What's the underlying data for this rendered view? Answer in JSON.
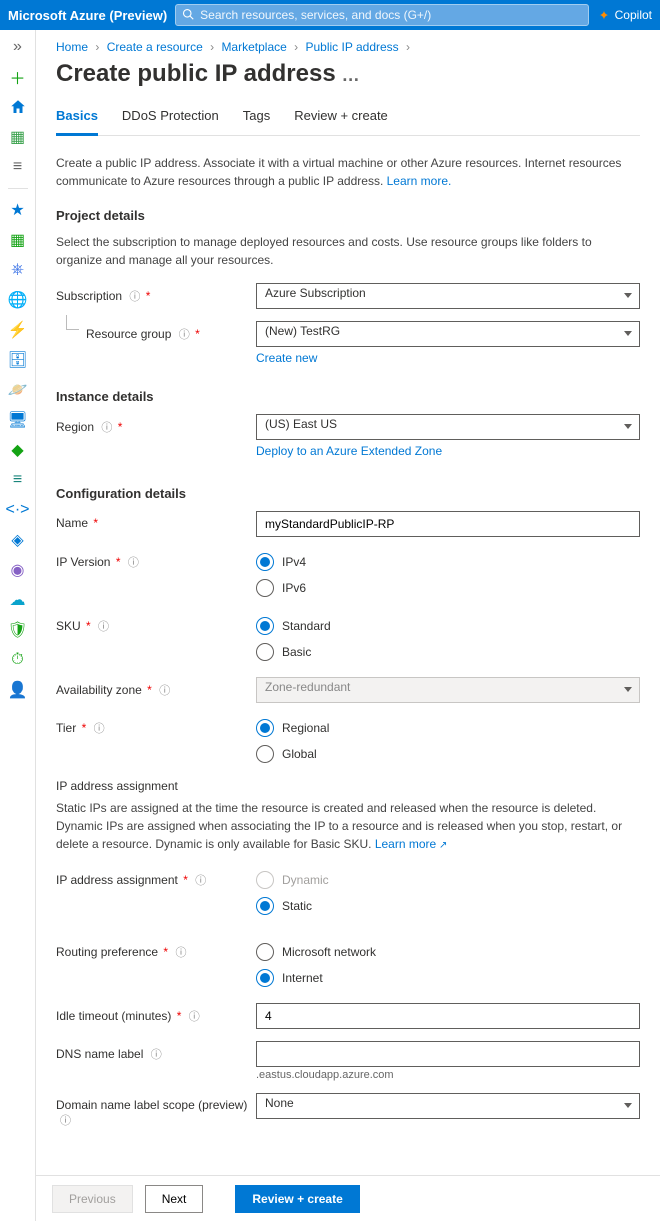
{
  "topbar": {
    "brand": "Microsoft Azure (Preview)",
    "search_placeholder": "Search resources, services, and docs (G+/)",
    "copilot": "Copilot"
  },
  "breadcrumb": {
    "items": [
      "Home",
      "Create a resource",
      "Marketplace",
      "Public IP address"
    ]
  },
  "page": {
    "title": "Create public IP address"
  },
  "tabs": {
    "items": [
      "Basics",
      "DDoS Protection",
      "Tags",
      "Review + create"
    ],
    "active": 0
  },
  "intro": {
    "text": "Create a public IP address. Associate it with a virtual machine or other Azure resources. Internet resources communicate to Azure resources through a public IP address. ",
    "learn_more": "Learn more."
  },
  "project": {
    "heading": "Project details",
    "help": "Select the subscription to manage deployed resources and costs. Use resource groups like folders to organize and manage all your resources.",
    "subscription_label": "Subscription",
    "subscription_value": "Azure Subscription",
    "rg_label": "Resource group",
    "rg_value": "(New) TestRG",
    "create_new": "Create new"
  },
  "instance": {
    "heading": "Instance details",
    "region_label": "Region",
    "region_value": "(US) East US",
    "extended_zone": "Deploy to an Azure Extended Zone"
  },
  "config": {
    "heading": "Configuration details",
    "name_label": "Name",
    "name_value": "myStandardPublicIP-RP",
    "ipver_label": "IP Version",
    "ipver_options": [
      "IPv4",
      "IPv6"
    ],
    "ipver_selected": "IPv4",
    "sku_label": "SKU",
    "sku_options": [
      "Standard",
      "Basic"
    ],
    "sku_selected": "Standard",
    "avzone_label": "Availability zone",
    "avzone_value": "Zone-redundant",
    "tier_label": "Tier",
    "tier_options": [
      "Regional",
      "Global"
    ],
    "tier_selected": "Regional"
  },
  "ipassign": {
    "heading": "IP address assignment",
    "desc": "Static IPs are assigned at the time the resource is created and released when the resource is deleted. Dynamic IPs are assigned when associating the IP to a resource and is released when you stop, restart, or delete a resource. Dynamic is only available for Basic SKU. ",
    "learn_more": "Learn more",
    "label": "IP address assignment",
    "options": [
      "Dynamic",
      "Static"
    ],
    "selected": "Static",
    "disabled": "Dynamic"
  },
  "routing": {
    "label": "Routing preference",
    "options": [
      "Microsoft network",
      "Internet"
    ],
    "selected": "Internet"
  },
  "idle": {
    "label": "Idle timeout (minutes)",
    "value": "4"
  },
  "dns": {
    "label": "DNS name label",
    "value": "",
    "suffix": ".eastus.cloudapp.azure.com"
  },
  "dlabelscope": {
    "label": "Domain name label scope (preview)",
    "value": "None"
  },
  "footer": {
    "prev": "Previous",
    "next": "Next",
    "review": "Review + create"
  }
}
